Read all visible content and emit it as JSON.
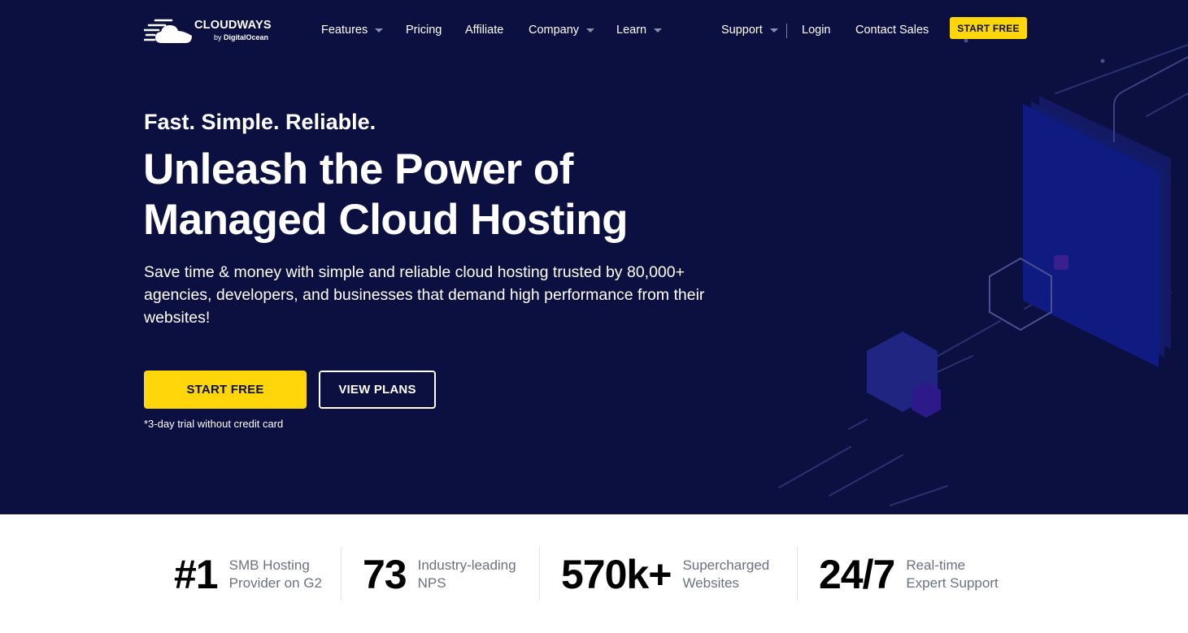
{
  "brand": {
    "name": "CLOUDWAYS",
    "sub_prefix": "by ",
    "sub_brand": "DigitalOcean"
  },
  "nav": {
    "items": [
      {
        "label": "Features",
        "has_dropdown": true
      },
      {
        "label": "Pricing",
        "has_dropdown": false
      },
      {
        "label": "Affiliate",
        "has_dropdown": false
      },
      {
        "label": "Company",
        "has_dropdown": true
      },
      {
        "label": "Learn",
        "has_dropdown": true
      }
    ],
    "right_items": [
      {
        "label": "Support",
        "has_dropdown": true
      },
      {
        "label": "Login",
        "has_dropdown": false
      },
      {
        "label": "Contact Sales",
        "has_dropdown": false
      }
    ],
    "cta_label": "START FREE"
  },
  "hero": {
    "tagline": "Fast. Simple. Reliable.",
    "headline": "Unleash the Power of Managed Cloud Hosting",
    "subtext": "Save time & money with simple and reliable cloud hosting trusted by 80,000+ agencies, developers, and businesses that demand high performance from their websites!",
    "primary_button": "START FREE",
    "secondary_button": "VIEW PLANS",
    "trial_note": "*3-day trial without credit card"
  },
  "stats": [
    {
      "value": "#1",
      "label": "SMB Hosting\nProvider on G2"
    },
    {
      "value": "73",
      "label": "Industry-leading\nNPS"
    },
    {
      "value": "570k+",
      "label": "Supercharged\nWebsites"
    },
    {
      "value": "24/7",
      "label": "Real-time\nExpert Support"
    }
  ],
  "colors": {
    "hero_bg": "#0c1040",
    "accent_yellow": "#ffd60a",
    "text_white": "#ffffff",
    "stat_label": "#6d7080"
  },
  "icons": {
    "logo": "cloud-logo-icon",
    "dropdown": "caret-down-icon"
  }
}
